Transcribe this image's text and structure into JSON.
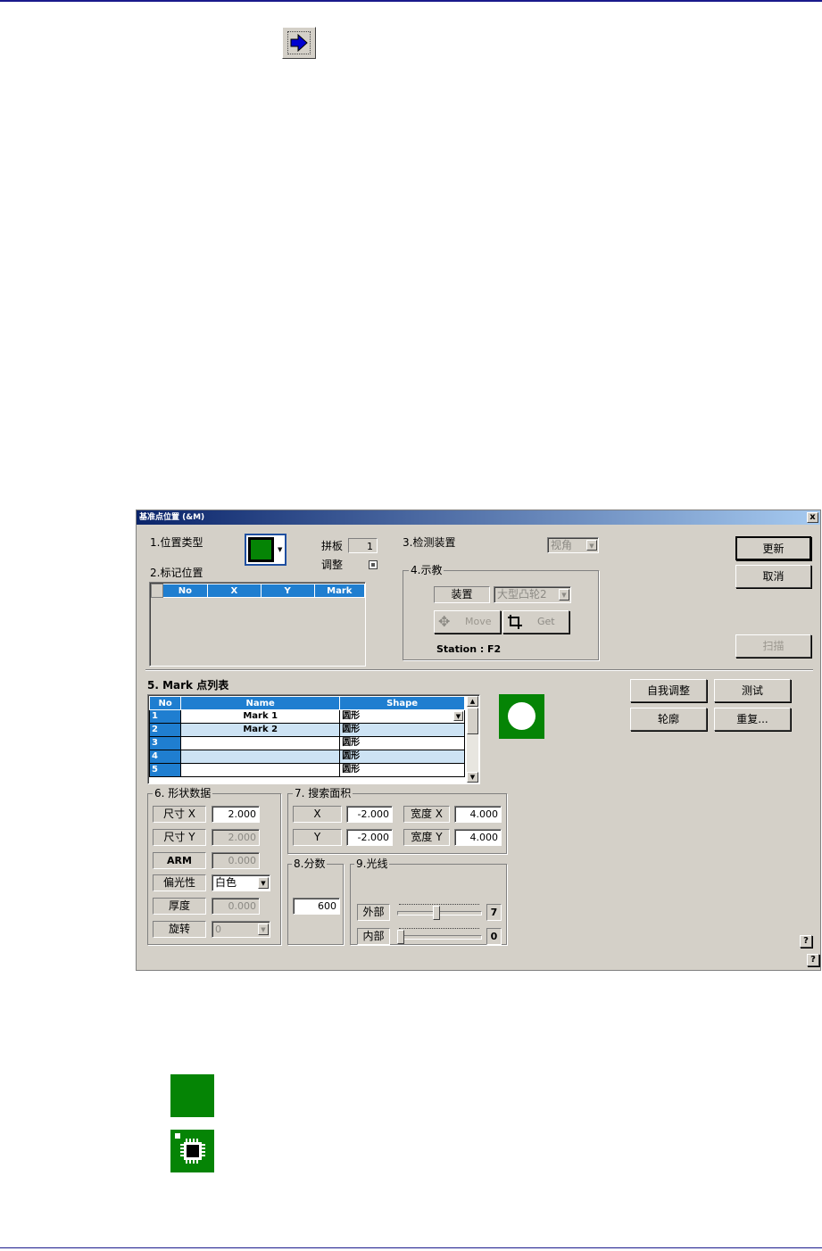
{
  "dialog": {
    "title": "基准点位置 (&M)",
    "close_label": "x",
    "sections": {
      "s1": "1.位置类型",
      "s2": "2.标记位置",
      "s3": "3.检测装置",
      "s4": "4.示教",
      "s5": "5. Mark 点列表",
      "s6": "6. 形状数据",
      "s7": "7. 搜索面积",
      "s8": "8.分数",
      "s9": "9.光线"
    },
    "panel": {
      "label": "拼板",
      "value": "1"
    },
    "adjust_label": "调整",
    "detect_device": {
      "value": "视角"
    },
    "teach": {
      "device_label": "装置",
      "device_value": "大型凸轮2",
      "move_label": "Move",
      "get_label": "Get",
      "station_label": "Station :",
      "station_value": "F2"
    },
    "buttons": {
      "update": "更新",
      "cancel": "取消",
      "scan": "扫描",
      "self_adjust": "自我调整",
      "test": "测试",
      "contour": "轮廓",
      "repeat": "重复...",
      "help": "?"
    },
    "mark_pos_table": {
      "columns": [
        "No",
        "X",
        "Y",
        "Mark"
      ]
    },
    "mark_list": {
      "columns": [
        "No",
        "Name",
        "Shape"
      ],
      "rows": [
        {
          "no": "1",
          "name": "Mark 1",
          "shape": "圆形"
        },
        {
          "no": "2",
          "name": "Mark 2",
          "shape": "圆形"
        },
        {
          "no": "3",
          "name": "",
          "shape": "圆形"
        },
        {
          "no": "4",
          "name": "",
          "shape": "圆形"
        },
        {
          "no": "5",
          "name": "",
          "shape": "圆形"
        }
      ]
    },
    "shape_data": {
      "size_x_label": "尺寸 X",
      "size_x_value": "2.000",
      "size_y_label": "尺寸 Y",
      "size_y_value": "2.000",
      "arm_label": "ARM",
      "arm_value": "0.000",
      "polarity_label": "偏光性",
      "polarity_value": "白色",
      "thickness_label": "厚度",
      "thickness_value": "0.000",
      "rotation_label": "旋转",
      "rotation_value": "0"
    },
    "search_area": {
      "x_label": "X",
      "x_value": "-2.000",
      "width_x_label": "宽度 X",
      "width_x_value": "4.000",
      "y_label": "Y",
      "y_value": "-2.000",
      "width_y_label": "宽度 Y",
      "width_y_value": "4.000"
    },
    "score": {
      "value": "600"
    },
    "light": {
      "outer_label": "外部",
      "outer_value": "7",
      "outer_level": 7,
      "inner_label": "内部",
      "inner_value": "0",
      "inner_level": 0
    }
  },
  "colors": {
    "accent_blue": "#1f7ed0",
    "mark_green": "#058405"
  }
}
